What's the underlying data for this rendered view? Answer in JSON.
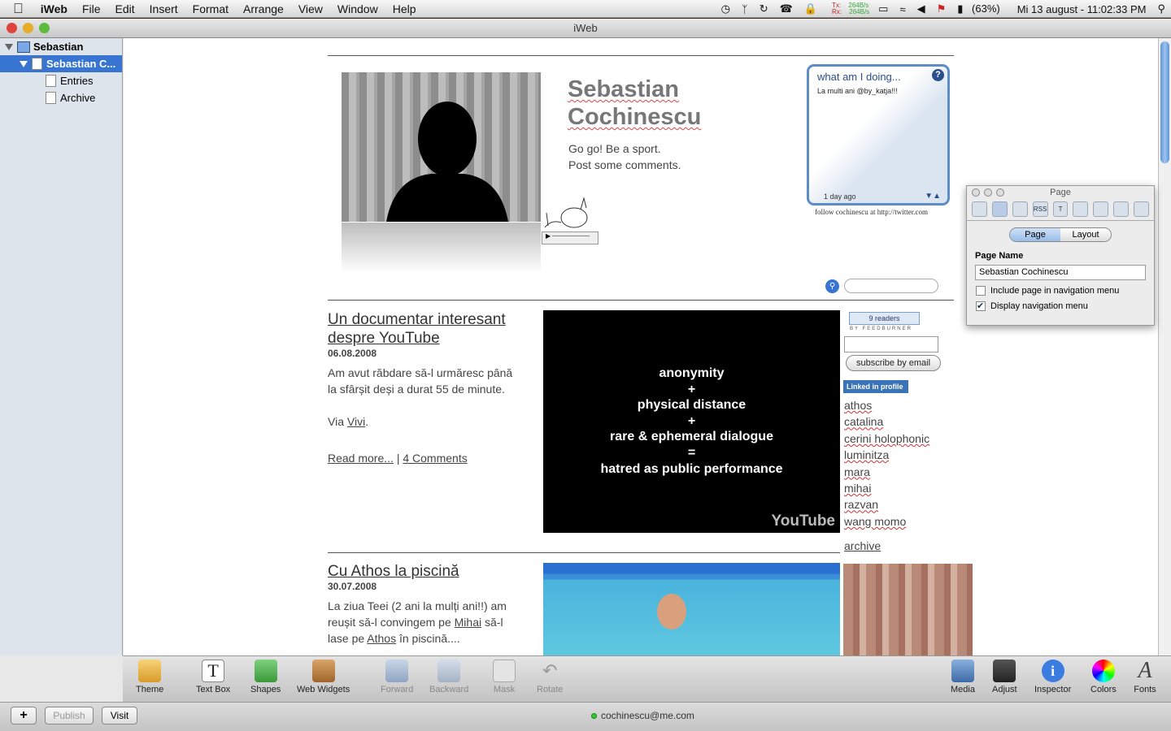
{
  "menubar": {
    "apple": "",
    "app": "iWeb",
    "items": [
      "File",
      "Edit",
      "Insert",
      "Format",
      "Arrange",
      "View",
      "Window",
      "Help"
    ],
    "net_tx": "Tx:",
    "net_rx": "Rx:",
    "net_tx_val": "264B/s",
    "net_rx_val": "264B/s",
    "battery": "(63%)",
    "clock": "Mi 13 august - 11:02:33 PM"
  },
  "window": {
    "title": "iWeb"
  },
  "sidebar": {
    "items": [
      {
        "label": "Sebastian"
      },
      {
        "label": "Sebastian C..."
      },
      {
        "label": "Entries"
      },
      {
        "label": "Archive"
      }
    ]
  },
  "page": {
    "name_line1": "Sebastian",
    "name_line2": "Cochinescu",
    "tagline1": "Go go! Be a sport.",
    "tagline2": "Post some comments.",
    "twitter": {
      "title": "what am I doing...",
      "tweet": "La multi ani @by_katja!!!",
      "ago": "1 day ago",
      "follow": "follow cochinescu at http://twitter.com"
    },
    "posts": [
      {
        "title1": "Un documentar interesant",
        "title2": "despre YouTube",
        "date": "06.08.2008",
        "body1": "Am avut răbdare să-l urmăresc până",
        "body2": "la sfârșit deși a durat 55 de minute.",
        "via": "Via ",
        "via_link": "Vivi",
        "via_end": ".",
        "read_more": "Read more...",
        "sep": " | ",
        "comments": "4 Comments",
        "video_lines": [
          "anonymity",
          "+",
          "physical distance",
          "+",
          "rare & ephemeral dialogue",
          "=",
          "hatred as public performance"
        ],
        "video_logo": "YouTube"
      },
      {
        "title": "Cu Athos la piscină",
        "date": "30.07.2008",
        "body1": "La ziua Teei (2 ani la mulți ani!!) am",
        "body2_a": "reușit să-l convingem pe ",
        "body2_link": "Mihai",
        "body2_b": " să-l",
        "body3_a": "lase pe ",
        "body3_link": "Athos",
        "body3_b": " în piscină...."
      }
    ],
    "feed": {
      "readers": "9 readers",
      "by": "BY FEEDBURNER",
      "subscribe": "subscribe by email"
    },
    "linkedin": "Linked in profile",
    "links": [
      "athos",
      "catalina",
      "cerini holophonic",
      "luminitza",
      "mara",
      "mihai",
      "razvan",
      "wang momo"
    ],
    "archive": "archive"
  },
  "toolbar": {
    "theme": "Theme",
    "textbox": "Text Box",
    "shapes": "Shapes",
    "widgets": "Web Widgets",
    "forward": "Forward",
    "backward": "Backward",
    "mask": "Mask",
    "rotate": "Rotate",
    "media": "Media",
    "adjust": "Adjust",
    "inspector": "Inspector",
    "colors": "Colors",
    "fonts": "Fonts"
  },
  "status": {
    "add": "+",
    "publish": "Publish",
    "visit": "Visit",
    "account": "cochinescu@me.com"
  },
  "inspector": {
    "title": "Page",
    "seg_page": "Page",
    "seg_layout": "Layout",
    "page_name_label": "Page Name",
    "page_name_value": "Sebastian Cochinescu",
    "opt1": "Include page in navigation menu",
    "opt1_checked": false,
    "opt2": "Display navigation menu",
    "opt2_checked": true
  }
}
